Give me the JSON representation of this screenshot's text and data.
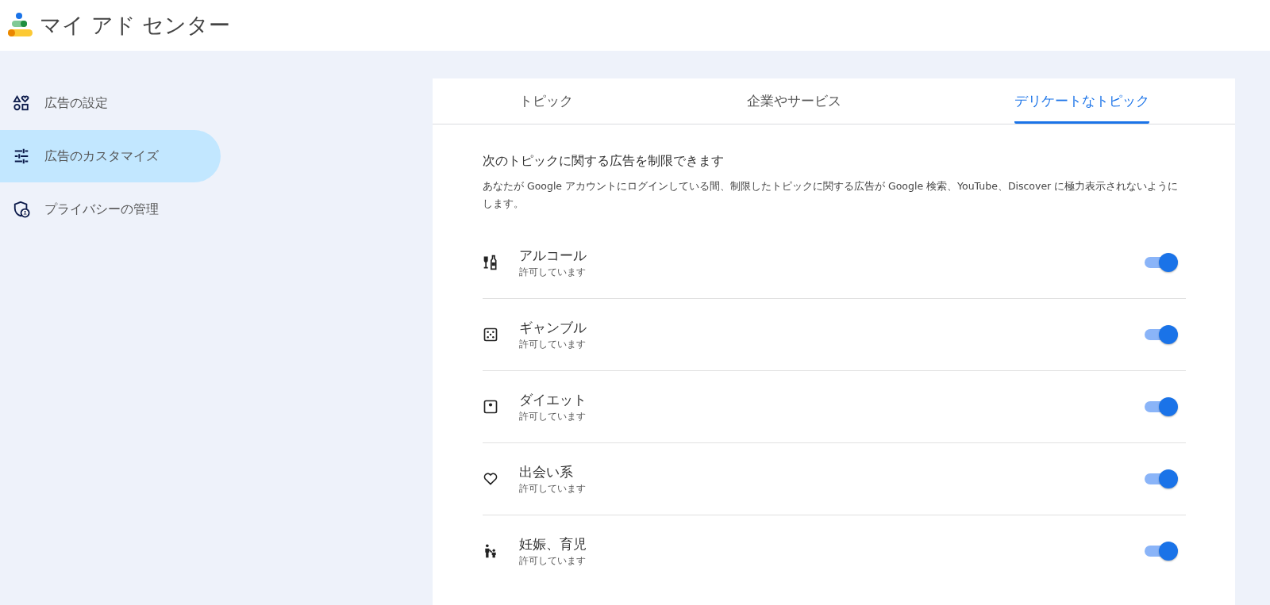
{
  "header": {
    "title": "マイ アド センター"
  },
  "sidebar": {
    "items": [
      {
        "kind": "settings",
        "label": "広告の設定",
        "selected": false
      },
      {
        "kind": "customize",
        "label": "広告のカスタマイズ",
        "selected": true
      },
      {
        "kind": "privacy",
        "label": "プライバシーの管理",
        "selected": false
      }
    ]
  },
  "tabs": [
    {
      "label": "トピック",
      "selected": false
    },
    {
      "label": "企業やサービス",
      "selected": false
    },
    {
      "label": "デリケートなトピック",
      "selected": true
    }
  ],
  "section": {
    "heading": "次のトピックに関する広告を制限できます",
    "description": "あなたが Google アカウントにログインしている間、制限したトピックに関する広告が Google 検索、YouTube、Discover に極力表示されないようにします。"
  },
  "topics": [
    {
      "kind": "alcohol",
      "name": "アルコール",
      "status": "許可しています",
      "on": true
    },
    {
      "kind": "gambling",
      "name": "ギャンブル",
      "status": "許可しています",
      "on": true
    },
    {
      "kind": "diet",
      "name": "ダイエット",
      "status": "許可しています",
      "on": true
    },
    {
      "kind": "dating",
      "name": "出会い系",
      "status": "許可しています",
      "on": true
    },
    {
      "kind": "parenting",
      "name": "妊娠、育児",
      "status": "許可しています",
      "on": true
    }
  ]
}
